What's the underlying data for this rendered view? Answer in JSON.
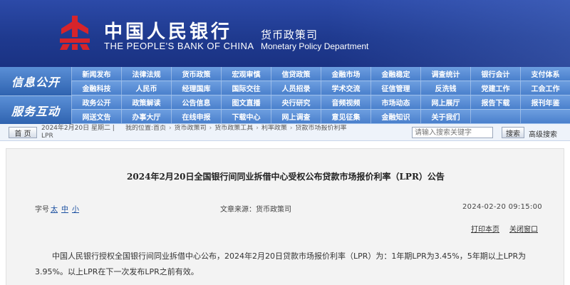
{
  "header": {
    "bank_name_cn": "中国人民银行",
    "bank_name_en": "THE PEOPLE'S BANK OF CHINA",
    "dept_cn": "货币政策司",
    "dept_en": "Monetary Policy Department",
    "logo_icon": "pboc-emblem-icon",
    "colors": {
      "banner_blue": "#1f3a8f",
      "emblem_red": "#d7242a",
      "nav_blue": "#4a80cc"
    }
  },
  "nav": {
    "section_1": "信息公开",
    "section_2": "服务互动",
    "rows": [
      [
        "新闻发布",
        "法律法规",
        "货币政策",
        "宏观审慎",
        "信贷政策",
        "金融市场",
        "金融稳定",
        "调查统计",
        "银行会计",
        "支付体系"
      ],
      [
        "金融科技",
        "人民币",
        "经理国库",
        "国际交往",
        "人员招录",
        "学术交流",
        "征信管理",
        "反洗钱",
        "党建工作",
        "工会工作"
      ],
      [
        "政务公开",
        "政策解读",
        "公告信息",
        "图文直播",
        "央行研究",
        "音频视频",
        "市场动态",
        "网上展厅",
        "报告下载",
        "报刊年鉴"
      ],
      [
        "网送文告",
        "办事大厅",
        "在线申报",
        "下载中心",
        "网上调查",
        "意见征集",
        "金融知识",
        "关于我们"
      ]
    ]
  },
  "crumbbar": {
    "home_label": "首 页",
    "date_text": "2024年2月20日 星期二 | LPR",
    "breadcrumb": [
      "我的位置:首页",
      "货币政策司",
      "货币政策工具",
      "利率政策",
      "贷款市场报价利率"
    ],
    "search_placeholder": "请输入搜索关键字",
    "search_label": "搜索",
    "advanced_search_label": "高级搜索"
  },
  "article": {
    "title": "2024年2月20日全国银行间同业拆借中心受权公布贷款市场报价利率（LPR）公告",
    "font_size_label": "字号",
    "font_sizes": [
      "太",
      "中",
      "小"
    ],
    "source": "文章来源：货币政策司",
    "publish_time": "2024-02-20 09:15:00",
    "print_label": "打印本页",
    "close_label": "关闭窗口",
    "body": "中国人民银行授权全国银行间同业拆借中心公布，2024年2月20日贷款市场报价利率（LPR）为：1年期LPR为3.45%，5年期以上LPR为3.95%。以上LPR在下一次发布LPR之前有效。"
  }
}
